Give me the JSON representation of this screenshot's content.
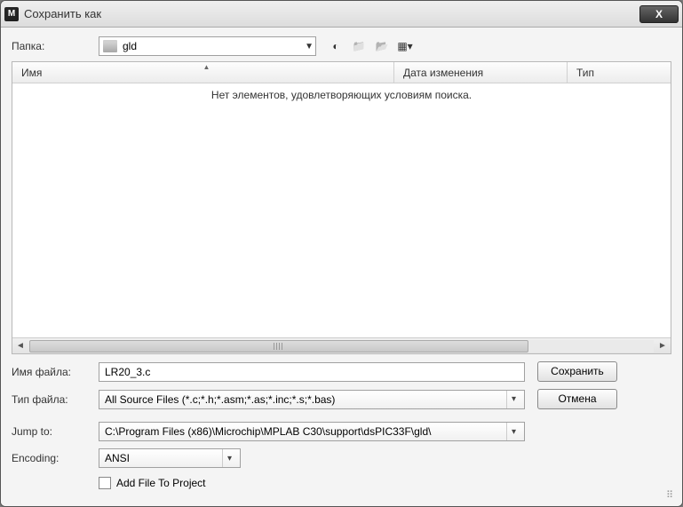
{
  "title": "Сохранить как",
  "folder": {
    "label": "Папка:",
    "value": "gld"
  },
  "toolbar_icons": [
    "back",
    "up",
    "new-folder",
    "view"
  ],
  "columns": {
    "name": "Имя",
    "date": "Дата изменения",
    "type": "Тип"
  },
  "empty_text": "Нет элементов, удовлетворяющих условиям поиска.",
  "filename": {
    "label": "Имя файла:",
    "value": "LR20_3.c"
  },
  "filetype": {
    "label": "Тип файла:",
    "value": "All Source Files (*.c;*.h;*.asm;*.as;*.inc;*.s;*.bas)"
  },
  "jump": {
    "label": "Jump to:",
    "value": "C:\\Program Files (x86)\\Microchip\\MPLAB C30\\support\\dsPIC33F\\gld\\"
  },
  "encoding": {
    "label": "Encoding:",
    "value": "ANSI"
  },
  "add_to_project": "Add File To Project",
  "buttons": {
    "save": "Сохранить",
    "cancel": "Отмена"
  }
}
